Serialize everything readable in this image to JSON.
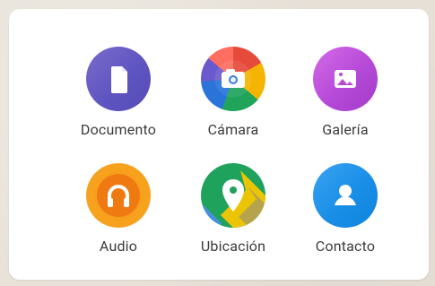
{
  "colors": {
    "panel": "#ffffff",
    "label": "#3b3b3b",
    "documento": "#5f55c2",
    "camara": "#e64a3b",
    "galeria": "#b64ad8",
    "audio": "#f7a11d",
    "ubicacion": "#1fa25b",
    "contacto": "#198ee7"
  },
  "items": [
    {
      "label": "Documento",
      "icon": "document-icon"
    },
    {
      "label": "Cámara",
      "icon": "camera-icon"
    },
    {
      "label": "Galería",
      "icon": "gallery-icon"
    },
    {
      "label": "Audio",
      "icon": "headphones-icon"
    },
    {
      "label": "Ubicación",
      "icon": "location-pin-icon"
    },
    {
      "label": "Contacto",
      "icon": "contact-icon"
    }
  ]
}
